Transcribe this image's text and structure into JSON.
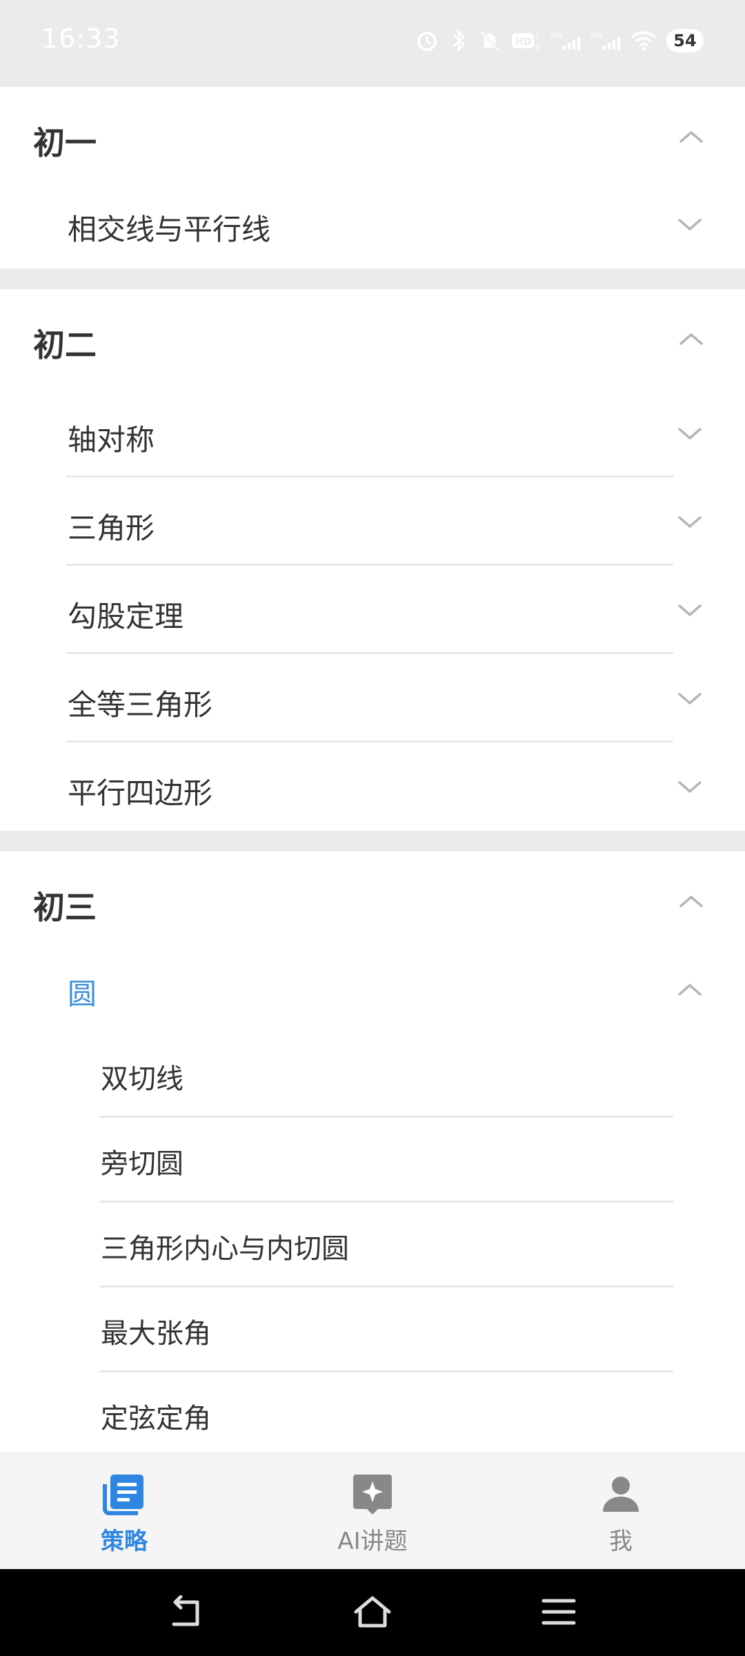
{
  "status_bar": {
    "time": "16:33",
    "icons": [
      "alarm-icon",
      "bluetooth-icon",
      "mute-icon",
      "hd-icon",
      "signal-5g-icon",
      "signal-5g-icon",
      "wifi-icon"
    ],
    "battery": "54"
  },
  "grades": [
    {
      "title": "初一",
      "expanded": true,
      "topics": [
        {
          "title": "相交线与平行线",
          "expanded": false
        }
      ]
    },
    {
      "title": "初二",
      "expanded": true,
      "topics": [
        {
          "title": "轴对称",
          "expanded": false
        },
        {
          "title": "三角形",
          "expanded": false
        },
        {
          "title": "勾股定理",
          "expanded": false
        },
        {
          "title": "全等三角形",
          "expanded": false
        },
        {
          "title": "平行四边形",
          "expanded": false
        }
      ]
    },
    {
      "title": "初三",
      "expanded": true,
      "topics": [
        {
          "title": "圆",
          "expanded": true,
          "items": [
            "双切线",
            "旁切圆",
            "三角形内心与内切圆",
            "最大张角",
            "定弦定角"
          ]
        }
      ]
    }
  ],
  "tabs": [
    {
      "label": "策略",
      "icon": "strategy-book-icon",
      "active": true
    },
    {
      "label": "AI讲题",
      "icon": "ai-sparkle-icon",
      "active": false
    },
    {
      "label": "我",
      "icon": "person-icon",
      "active": false
    }
  ],
  "colors": {
    "accent": "#2f86e0",
    "active_topic": "#3b8fdb",
    "background": "#ebebeb",
    "card": "#ffffff",
    "text": "#333333"
  }
}
